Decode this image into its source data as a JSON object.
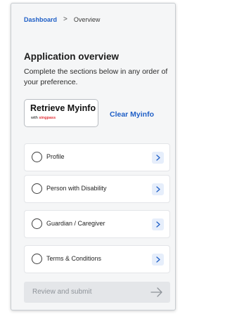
{
  "breadcrumb": {
    "parent": "Dashboard",
    "separator": ">",
    "current": "Overview"
  },
  "header": {
    "title": "Application overview",
    "description": "Complete the sections below in any order of your preference."
  },
  "myinfo": {
    "retrieve_label": "Retrieve Myinfo",
    "with_label": "with",
    "brand": "singpass",
    "clear_label": "Clear Myinfo"
  },
  "sections": [
    {
      "label": "Profile",
      "completed": false
    },
    {
      "label": "Person with Disability",
      "completed": false
    },
    {
      "label": "Guardian / Caregiver",
      "completed": false
    },
    {
      "label": "Terms & Conditions",
      "completed": false
    }
  ],
  "submit": {
    "label": "Review and submit",
    "enabled": false
  },
  "colors": {
    "link_blue": "#1f5fc7",
    "chevron_bg": "#e6eefb",
    "disabled_bg": "#e4e6e9",
    "singpass_red": "#e2333a"
  }
}
